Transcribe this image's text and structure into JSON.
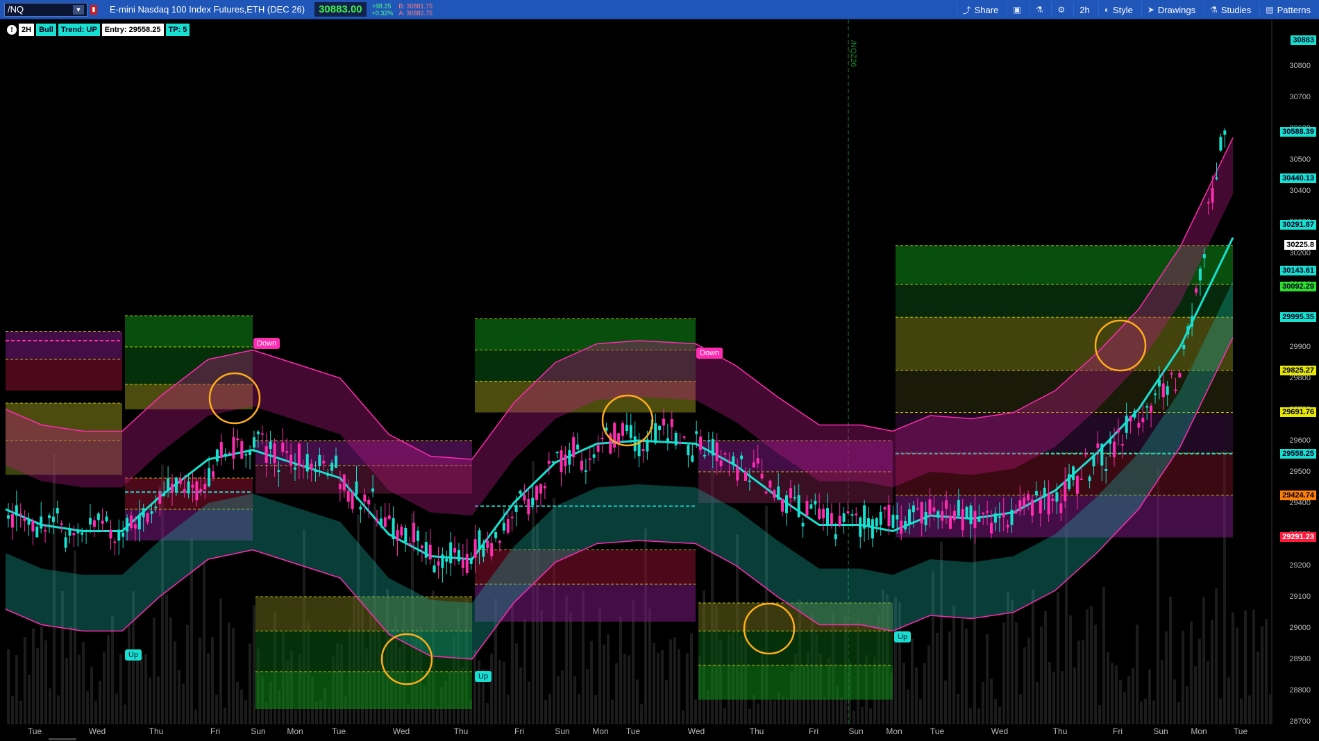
{
  "toolbar": {
    "symbol": "/NQ",
    "instrument": "E-mini Nasdaq 100 Index Futures,ETH (DEC 26)",
    "last": "30883.00",
    "change": "+98.25",
    "change_pct": "+0.32%",
    "bid": "B: 30881.75",
    "ask": "A: 30882.75",
    "share": "Share",
    "interval": "2h",
    "style": "Style",
    "drawings": "Drawings",
    "studies": "Studies",
    "patterns": "Patterns"
  },
  "info": {
    "timeframe": "2H",
    "bias": "Bull",
    "trend": "Trend: UP",
    "entry": "Entry: 29558.25",
    "tp": "TP: 5"
  },
  "vline_label": "/NQZ26",
  "yaxis": {
    "ticks": [
      "30800",
      "30700",
      "30600",
      "30500",
      "30400",
      "30300",
      "30200",
      "30100",
      "30000",
      "29900",
      "29800",
      "29700",
      "29600",
      "29500",
      "29400",
      "29300",
      "29200",
      "29100",
      "29000",
      "28900",
      "28800",
      "28700"
    ],
    "bubbles": [
      {
        "text": "30883",
        "bg": "#18e0d0",
        "fg": "#002"
      },
      {
        "text": "30588.39",
        "bg": "#18e0d0",
        "fg": "#002"
      },
      {
        "text": "30440.13",
        "bg": "#18e0d0",
        "fg": "#002"
      },
      {
        "text": "30291.87",
        "bg": "#18e0d0",
        "fg": "#002"
      },
      {
        "text": "30225.8",
        "bg": "#ffffff",
        "fg": "#000"
      },
      {
        "text": "30143.61",
        "bg": "#18e0d0",
        "fg": "#002"
      },
      {
        "text": "30092.29",
        "bg": "#2dde2d",
        "fg": "#002"
      },
      {
        "text": "29995.35",
        "bg": "#18e0d0",
        "fg": "#002"
      },
      {
        "text": "29825.27",
        "bg": "#e6e600",
        "fg": "#002"
      },
      {
        "text": "29691.76",
        "bg": "#e6e600",
        "fg": "#002"
      },
      {
        "text": "29558.25",
        "bg": "#18e0d0",
        "fg": "#002"
      },
      {
        "text": "29424.74",
        "bg": "#ff7f00",
        "fg": "#002"
      },
      {
        "text": "29291.23",
        "bg": "#ff1a3c",
        "fg": "#fff"
      }
    ]
  },
  "xaxis": [
    "Tue",
    "Wed",
    "Thu",
    "Fri",
    "Sun",
    "Mon",
    "Tue",
    "Wed",
    "Thu",
    "Fri",
    "Sun",
    "Mon",
    "Tue",
    "Wed",
    "Thu",
    "Fri",
    "Sun",
    "Mon",
    "Tue",
    "Wed",
    "Thu",
    "Fri",
    "Sun",
    "Mon",
    "Tue"
  ],
  "signals": {
    "up": "Up",
    "down": "Down"
  },
  "colors": {
    "cyan": "#18e0d0",
    "magenta": "#ff2bb0",
    "green_zone": "#0f8f1a",
    "yellow_zone": "#8a8a1a",
    "red_zone": "#8a1030",
    "purple_zone": "#7a1a80",
    "circle": "#ffae1a"
  }
}
